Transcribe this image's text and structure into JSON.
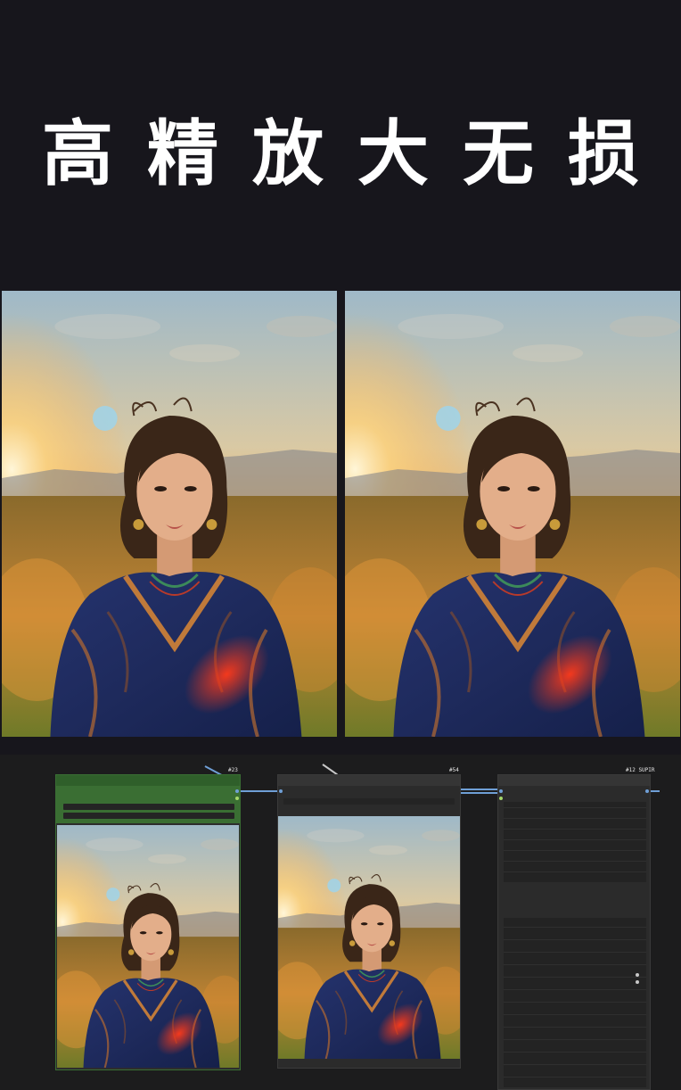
{
  "banner": {
    "title": "高精放大无损"
  },
  "comparison": {
    "left_label": "",
    "right_label": ""
  },
  "node_canvas": {
    "nodes": [
      {
        "id": "#23",
        "title": ""
      },
      {
        "id": "#54",
        "title": ""
      },
      {
        "id": "#12 SUPIR",
        "title": ""
      }
    ],
    "colors": {
      "green_node": "#3a6e33",
      "gray_node": "#353535",
      "wire": "#6f9fd6",
      "canvas": "#1c1c1d"
    }
  }
}
